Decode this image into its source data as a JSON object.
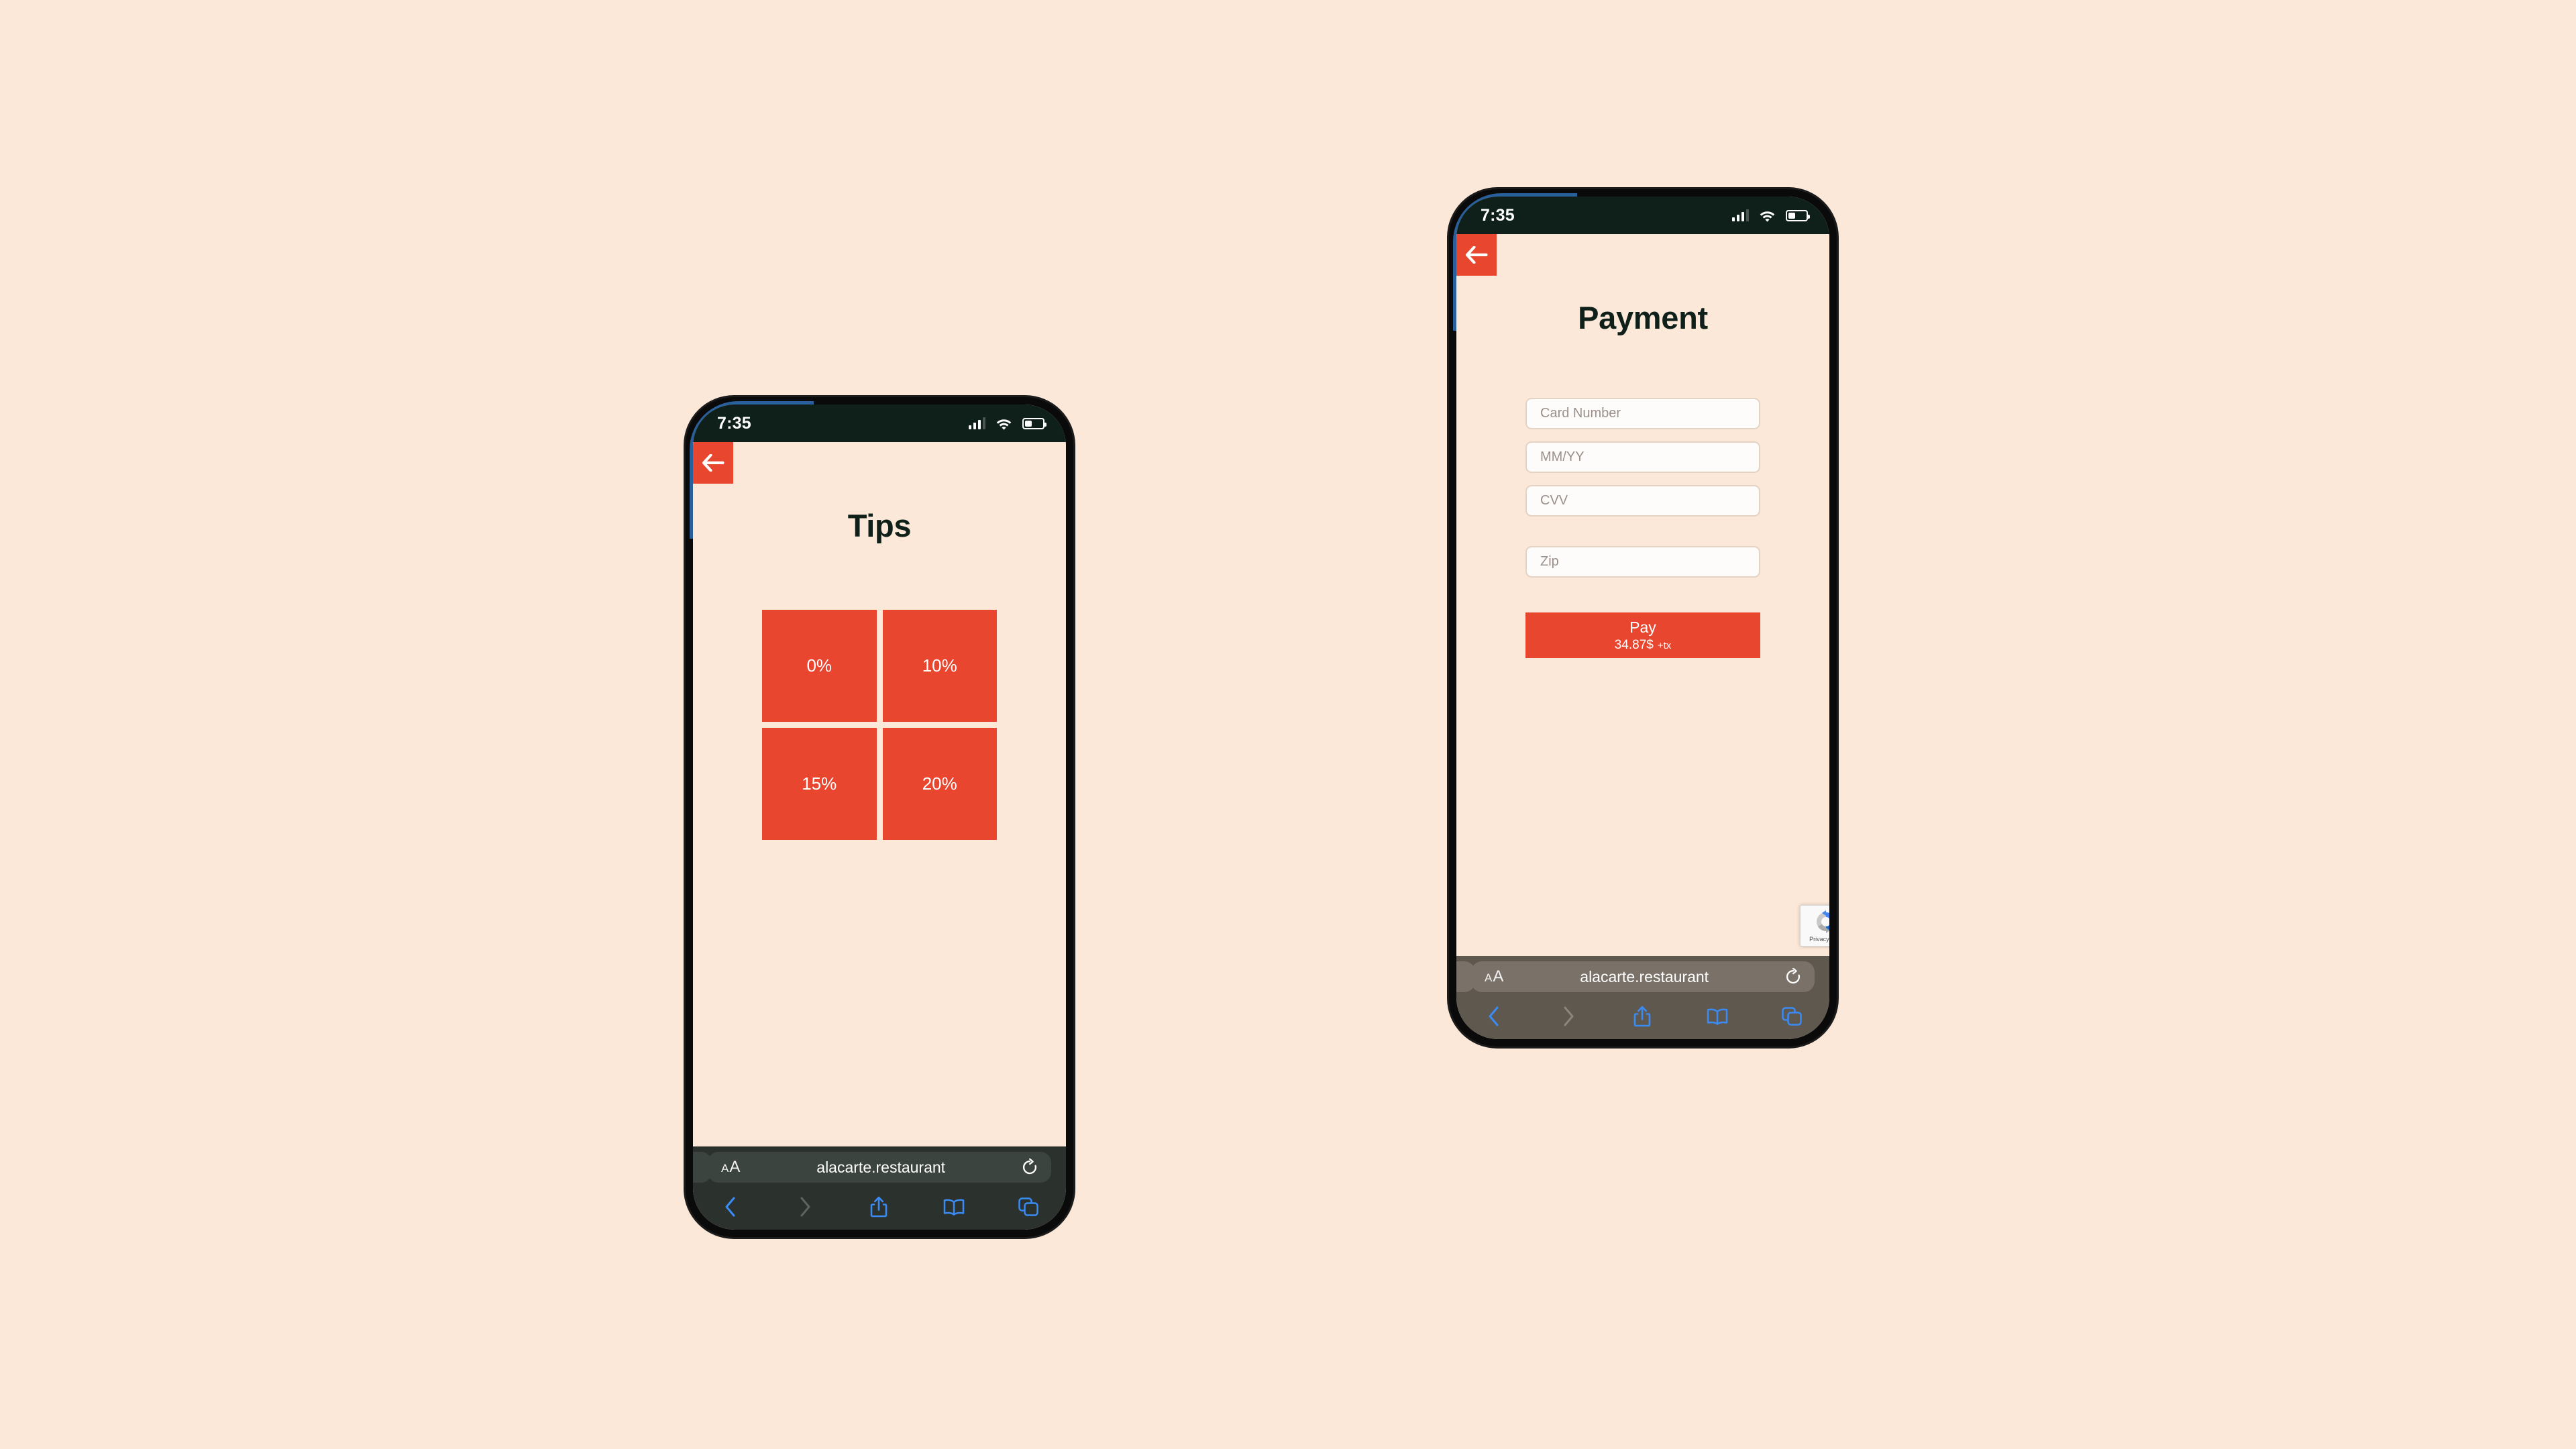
{
  "canvas": {
    "background": "#FCE8D8"
  },
  "theme": {
    "accent": "#E8462F",
    "page_bg": "#FCE8D8",
    "ink": "#0E2019",
    "status_bg": "#0E2019",
    "safari_blue": "#3B8BF5"
  },
  "phones": [
    {
      "id": "tips-phone",
      "status_bar": {
        "time": "7:35",
        "cellular_icon": "cellular-signal-icon",
        "wifi_icon": "wifi-icon",
        "battery_icon": "battery-icon",
        "battery_level_pct": 42
      },
      "back_button": {
        "icon": "arrow-left-icon",
        "label": "Back"
      },
      "title": "Tips",
      "tips": [
        {
          "label": "0%",
          "value": 0
        },
        {
          "label": "10%",
          "value": 10
        },
        {
          "label": "15%",
          "value": 15
        },
        {
          "label": "20%",
          "value": 20
        }
      ],
      "browser": {
        "text_size_button": {
          "small": "A",
          "large": "A"
        },
        "url": "alacarte.restaurant",
        "reload_icon": "reload-icon",
        "toolbar": [
          {
            "name": "back",
            "icon": "chevron-left-icon",
            "enabled": true
          },
          {
            "name": "forward",
            "icon": "chevron-right-icon",
            "enabled": false
          },
          {
            "name": "share",
            "icon": "share-icon",
            "enabled": true
          },
          {
            "name": "bookmarks",
            "icon": "book-icon",
            "enabled": true
          },
          {
            "name": "tabs",
            "icon": "tabs-icon",
            "enabled": true
          }
        ]
      }
    },
    {
      "id": "payment-phone",
      "status_bar": {
        "time": "7:35",
        "cellular_icon": "cellular-signal-icon",
        "wifi_icon": "wifi-icon",
        "battery_icon": "battery-icon",
        "battery_level_pct": 42
      },
      "back_button": {
        "icon": "arrow-left-icon",
        "label": "Back"
      },
      "title": "Payment",
      "fields": [
        {
          "name": "card-number",
          "placeholder": "Card Number",
          "value": ""
        },
        {
          "name": "expiry",
          "placeholder": "MM/YY",
          "value": ""
        },
        {
          "name": "cvv",
          "placeholder": "CVV",
          "value": ""
        },
        {
          "name": "zip",
          "placeholder": "Zip",
          "value": ""
        }
      ],
      "pay_button": {
        "label": "Pay",
        "amount": "34.87$",
        "tax_note": "+tx"
      },
      "recaptcha": {
        "logo_icon": "recaptcha-logo-icon",
        "text": "Privacy - Ter"
      },
      "browser": {
        "text_size_button": {
          "small": "A",
          "large": "A"
        },
        "url": "alacarte.restaurant",
        "reload_icon": "reload-icon",
        "toolbar": [
          {
            "name": "back",
            "icon": "chevron-left-icon",
            "enabled": true
          },
          {
            "name": "forward",
            "icon": "chevron-right-icon",
            "enabled": false
          },
          {
            "name": "share",
            "icon": "share-icon",
            "enabled": true
          },
          {
            "name": "bookmarks",
            "icon": "book-icon",
            "enabled": true
          },
          {
            "name": "tabs",
            "icon": "tabs-icon",
            "enabled": true
          }
        ]
      }
    }
  ]
}
